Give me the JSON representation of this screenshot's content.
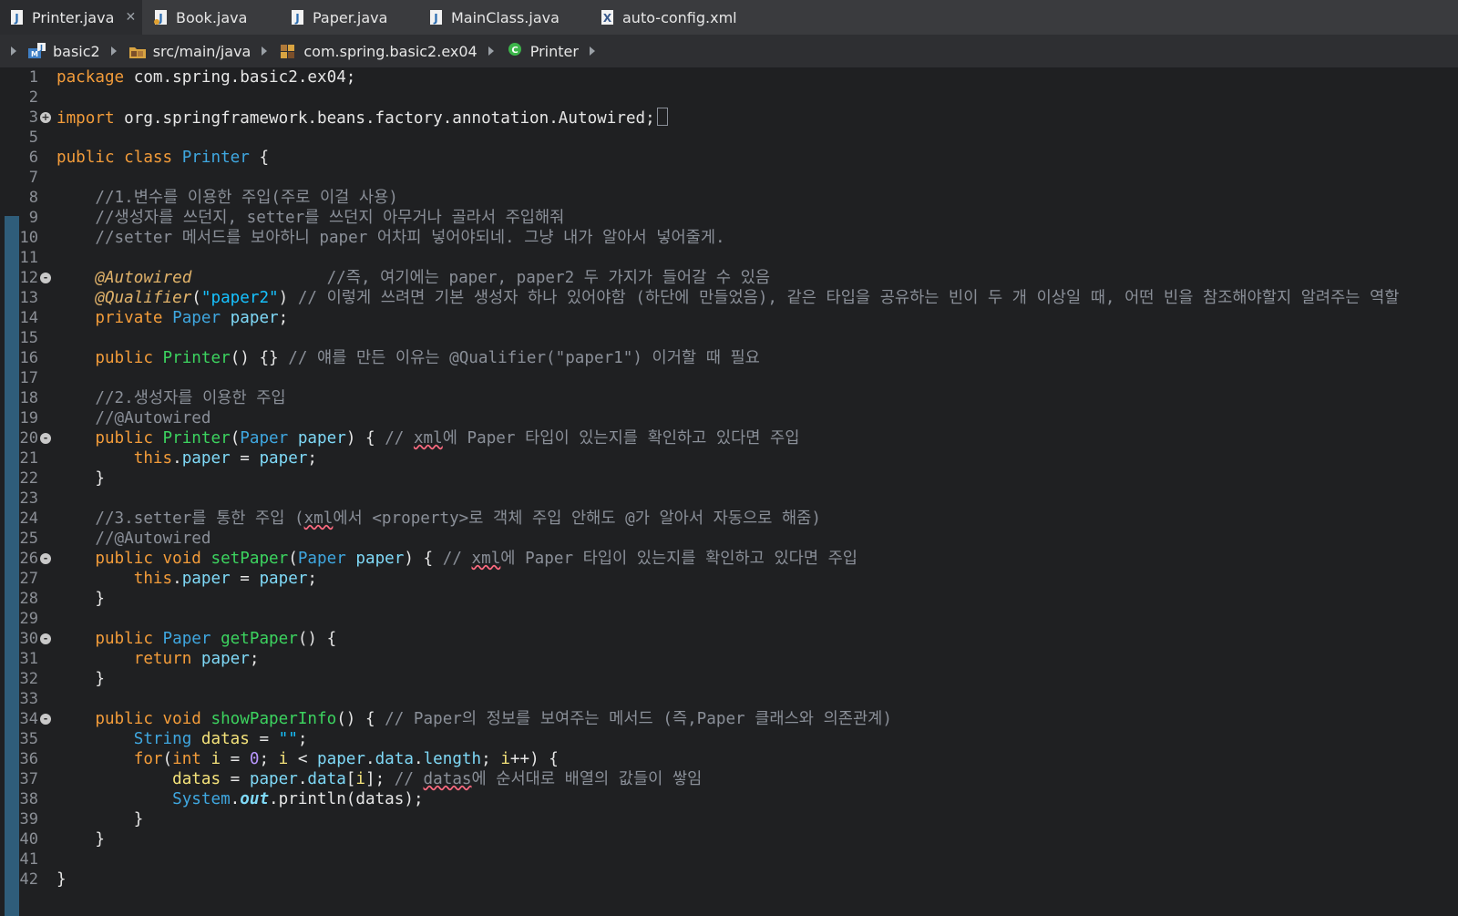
{
  "tabs": [
    {
      "label": "Printer.java",
      "icon": "java-file-icon",
      "active": true
    },
    {
      "label": "Book.java",
      "icon": "java-file-icon"
    },
    {
      "label": "Paper.java",
      "icon": "java-file-icon"
    },
    {
      "label": "MainClass.java",
      "icon": "java-file-icon"
    },
    {
      "label": "auto-config.xml",
      "icon": "xml-file-icon"
    }
  ],
  "breadcrumbs": [
    {
      "label": "basic2",
      "icon": "maven-project-icon"
    },
    {
      "label": "src/main/java",
      "icon": "source-folder-icon"
    },
    {
      "label": "com.spring.basic2.ex04",
      "icon": "package-icon"
    },
    {
      "label": "Printer",
      "icon": "class-icon"
    }
  ],
  "lines": [
    {
      "n": "1"
    },
    {
      "n": "2"
    },
    {
      "n": "3",
      "fold": "+"
    },
    {
      "n": "5"
    },
    {
      "n": "6"
    },
    {
      "n": "7"
    },
    {
      "n": "8"
    },
    {
      "n": "9"
    },
    {
      "n": "10"
    },
    {
      "n": "11"
    },
    {
      "n": "12",
      "fold": "-"
    },
    {
      "n": "13"
    },
    {
      "n": "14"
    },
    {
      "n": "15"
    },
    {
      "n": "16"
    },
    {
      "n": "17"
    },
    {
      "n": "18"
    },
    {
      "n": "19"
    },
    {
      "n": "20",
      "fold": "-"
    },
    {
      "n": "21"
    },
    {
      "n": "22"
    },
    {
      "n": "23"
    },
    {
      "n": "24"
    },
    {
      "n": "25"
    },
    {
      "n": "26",
      "fold": "-"
    },
    {
      "n": "27"
    },
    {
      "n": "28"
    },
    {
      "n": "29"
    },
    {
      "n": "30",
      "fold": "-"
    },
    {
      "n": "31"
    },
    {
      "n": "32"
    },
    {
      "n": "33"
    },
    {
      "n": "34",
      "fold": "-"
    },
    {
      "n": "35"
    },
    {
      "n": "36"
    },
    {
      "n": "37"
    },
    {
      "n": "38"
    },
    {
      "n": "39"
    },
    {
      "n": "40"
    },
    {
      "n": "41"
    },
    {
      "n": "42"
    }
  ],
  "code": {
    "l1_kw": "package",
    "l1_rest": " com.spring.basic2.ex04;",
    "l3_kw": "import",
    "l3_rest": " org.springframework.beans.factory.annotation.Autowired;",
    "l6_kw": "public class",
    "l6_cls": "Printer",
    "l6_rest": " {",
    "l8": "    //1.변수를 이용한 주입(주로 이걸 사용)",
    "l9": "    //생성자를 쓰던지, setter를 쓰던지 아무거나 골라서 주입해줘",
    "l10": "    //setter 메서드를 보아하니 paper 어차피 넣어야되네. 그냥 내가 알아서 넣어줄게.",
    "l12_ann": "    @Autowired",
    "l12_cm": "              //즉, 여기에는 paper, paper2 두 가지가 들어갈 수 있음",
    "l13_ann": "    @Qualifier",
    "l13_p1": "(",
    "l13_str": "\"paper2\"",
    "l13_p2": ")",
    "l13_cm": " // 이렇게 쓰려면 기본 생성자 하나 있어야함 (하단에 만들었음), 같은 타입을 공유하는 빈이 두 개 이상일 때, 어떤 빈을 참조해야할지 알려주는 역할",
    "l14_kw": "    private",
    "l14_cls": " Paper",
    "l14_fld": " paper",
    "l14_rest": ";",
    "l16_kw": "    public",
    "l16_meth": " Printer",
    "l16_rest": "() {}",
    "l16_cm": " // 얘를 만든 이유는 @Qualifier(\"paper1\") 이거할 때 필요",
    "l18": "    //2.생성자를 이용한 주입",
    "l19": "    //@Autowired",
    "l20_kw": "    public",
    "l20_meth": " Printer",
    "l20_p": "(",
    "l20_cls": "Paper",
    "l20_par": " paper",
    "l20_rest": ") { ",
    "l20_cm1": "// ",
    "l20_ul": "xml",
    "l20_cm2": "에 Paper 타입이 있는지를 확인하고 있다면 주입",
    "l21_kw": "        this",
    "l21_dot": ".",
    "l21_fld": "paper",
    "l21_eq": " = ",
    "l21_par": "paper",
    "l21_end": ";",
    "l22": "    }",
    "l24_a": "    //3.setter를 통한 주입 (",
    "l24_ul": "xml",
    "l24_b": "에서 <property>로 객체 주입 안해도 @가 알아서 자동으로 해줌)",
    "l25": "    //@Autowired",
    "l26_kw": "    public void",
    "l26_meth": " setPaper",
    "l26_p": "(",
    "l26_cls": "Paper",
    "l26_par": " paper",
    "l26_rest": ") { ",
    "l26_cm1": "// ",
    "l26_ul": "xml",
    "l26_cm2": "에 Paper 타입이 있는지를 확인하고 있다면 주입",
    "l27_kw": "        this",
    "l27_dot": ".",
    "l27_fld": "paper",
    "l27_eq": " = ",
    "l27_par": "paper",
    "l27_end": ";",
    "l28": "    }",
    "l30_kw": "    public",
    "l30_cls": " Paper",
    "l30_meth": " getPaper",
    "l30_rest": "() {",
    "l31_kw": "        return",
    "l31_fld": " paper",
    "l31_end": ";",
    "l32": "    }",
    "l34_kw": "    public void",
    "l34_meth": " showPaperInfo",
    "l34_rest": "() { ",
    "l34_cm": "// Paper의 정보를 보여주는 메서드 (즉,Paper 클래스와 의존관계)",
    "l35_cls": "        String",
    "l35_var": " datas",
    "l35_eq": " = ",
    "l35_str": "\"\"",
    "l35_end": ";",
    "l36_kw": "        for",
    "l36_p": "(",
    "l36_kw2": "int",
    "l36_i": " i",
    "l36_eq": " = ",
    "l36_num": "0",
    "l36_a": "; ",
    "l36_i2": "i",
    "l36_b": " < ",
    "l36_fld1": "paper",
    "l36_d1": ".",
    "l36_fld2": "data",
    "l36_d2": ".",
    "l36_fld3": "length",
    "l36_c": "; ",
    "l36_i3": "i",
    "l36_d": "++) {",
    "l37_var": "            datas",
    "l37_eq": " = ",
    "l37_fld1": "paper",
    "l37_d": ".",
    "l37_fld2": "data",
    "l37_br1": "[",
    "l37_i": "i",
    "l37_br2": "]",
    "l37_e": "; ",
    "l37_cm1": "// ",
    "l37_ul": "datas",
    "l37_cm2": "에 순서대로 배열의 값들이 쌓임",
    "l38_cls": "            System",
    "l38_d": ".",
    "l38_out": "out",
    "l38_d2": ".",
    "l38_m": "println",
    "l38_r": "(datas);",
    "l39": "        }",
    "l40": "    }",
    "l42": "}"
  }
}
